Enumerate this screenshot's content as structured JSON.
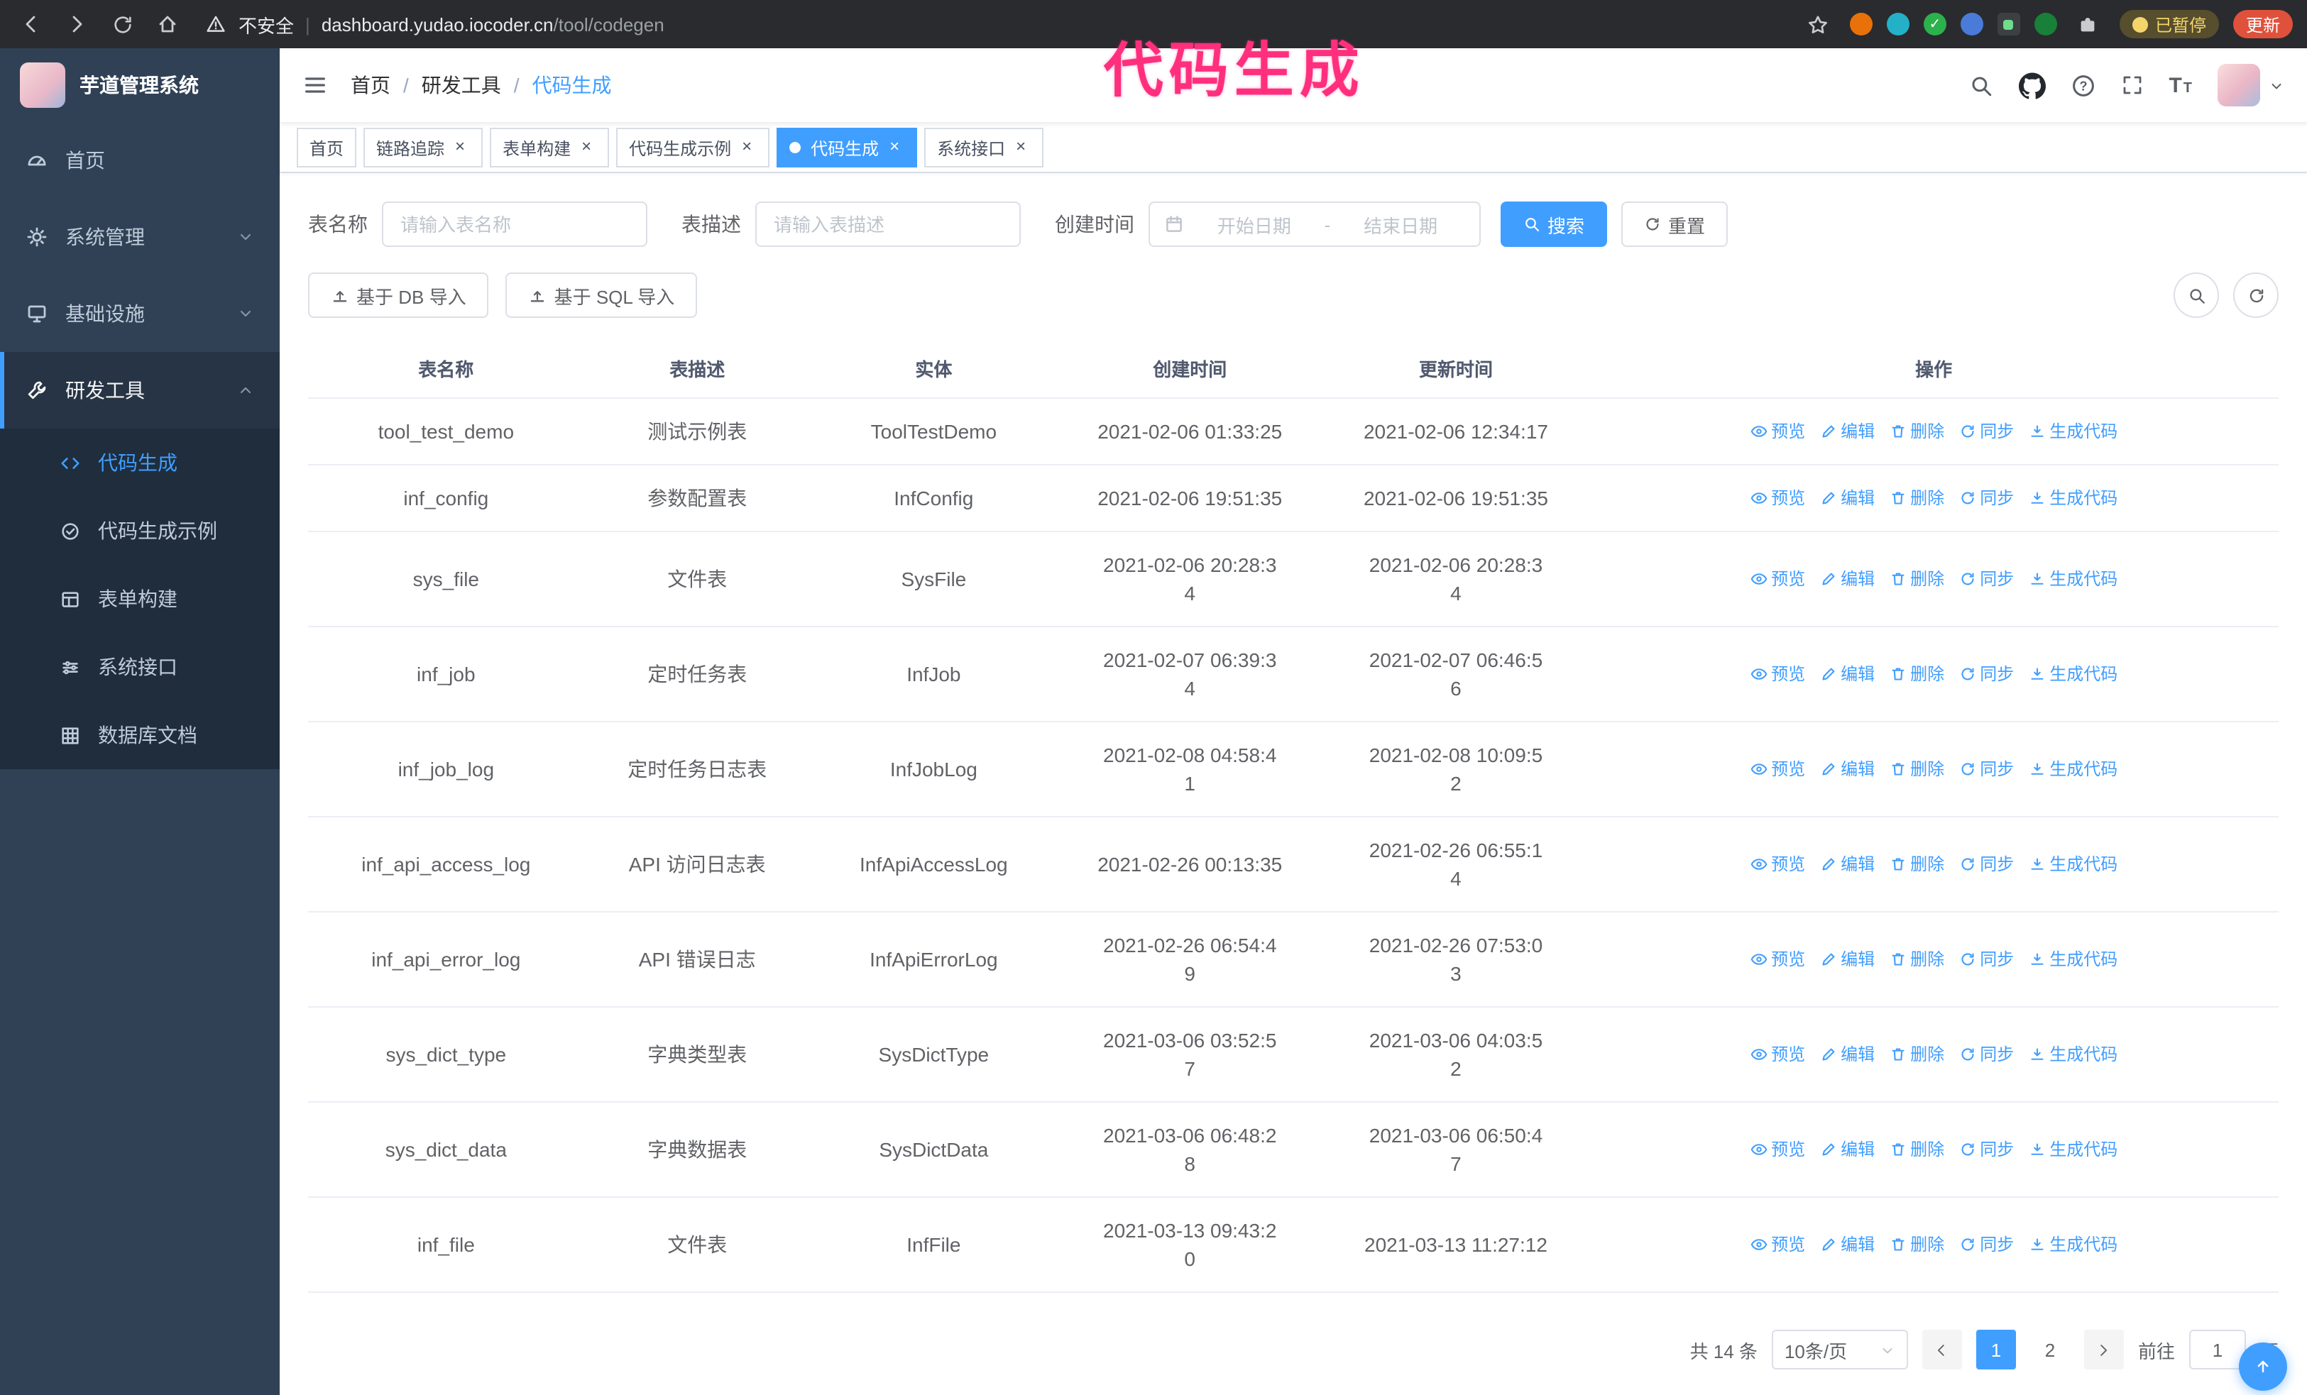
{
  "browser": {
    "security_warning": "不安全",
    "url_domain": "dashboard.yudao.iocoder.cn",
    "url_path": "/tool/codegen",
    "url_separator": "|",
    "paused_badge": "已暂停",
    "update_button": "更新"
  },
  "annotation": {
    "text": "代码生成",
    "color": "#ff2f7e"
  },
  "app": {
    "title": "芋道管理系统"
  },
  "sidebar": {
    "items": [
      {
        "label": "首页",
        "icon": "dashboard-icon"
      },
      {
        "label": "系统管理",
        "icon": "gear-icon"
      },
      {
        "label": "基础设施",
        "icon": "platform-icon"
      },
      {
        "label": "研发工具",
        "icon": "tools-icon"
      }
    ],
    "submenu": [
      {
        "label": "代码生成",
        "icon": "code-icon",
        "active": true
      },
      {
        "label": "代码生成示例",
        "icon": "example-icon"
      },
      {
        "label": "表单构建",
        "icon": "form-icon"
      },
      {
        "label": "系统接口",
        "icon": "api-icon"
      },
      {
        "label": "数据库文档",
        "icon": "db-doc-icon"
      }
    ]
  },
  "breadcrumb": [
    "首页",
    "研发工具",
    "代码生成"
  ],
  "navbar": {
    "font_icon_large": "T",
    "font_icon_small": "T"
  },
  "tabs": [
    {
      "label": "首页",
      "closable": false,
      "active": false
    },
    {
      "label": "链路追踪",
      "closable": true,
      "active": false
    },
    {
      "label": "表单构建",
      "closable": true,
      "active": false
    },
    {
      "label": "代码生成示例",
      "closable": true,
      "active": false
    },
    {
      "label": "代码生成",
      "closable": true,
      "active": true
    },
    {
      "label": "系统接口",
      "closable": true,
      "active": false
    }
  ],
  "filters": {
    "table_name_label": "表名称",
    "table_name_placeholder": "请输入表名称",
    "table_desc_label": "表描述",
    "table_desc_placeholder": "请输入表描述",
    "create_time_label": "创建时间",
    "date_start_placeholder": "开始日期",
    "date_separator": "-",
    "date_end_placeholder": "结束日期",
    "search_button": "搜索",
    "reset_button": "重置"
  },
  "toolbar": {
    "import_db": "基于 DB 导入",
    "import_sql": "基于 SQL 导入"
  },
  "table": {
    "columns": [
      "表名称",
      "表描述",
      "实体",
      "创建时间",
      "更新时间",
      "操作"
    ],
    "actions": [
      {
        "label": "预览",
        "icon": "eye"
      },
      {
        "label": "编辑",
        "icon": "edit"
      },
      {
        "label": "删除",
        "icon": "del"
      },
      {
        "label": "同步",
        "icon": "sync"
      },
      {
        "label": "生成代码",
        "icon": "code"
      }
    ],
    "rows": [
      {
        "name": "tool_test_demo",
        "desc": "测试示例表",
        "entity": "ToolTestDemo",
        "created": "2021-02-06 01:33:25",
        "updated": "2021-02-06 12:34:17"
      },
      {
        "name": "inf_config",
        "desc": "参数配置表",
        "entity": "InfConfig",
        "created": "2021-02-06 19:51:35",
        "updated": "2021-02-06 19:51:35"
      },
      {
        "name": "sys_file",
        "desc": "文件表",
        "entity": "SysFile",
        "created": "2021-02-06 20:28:3\n4",
        "updated": "2021-02-06 20:28:3\n4"
      },
      {
        "name": "inf_job",
        "desc": "定时任务表",
        "entity": "InfJob",
        "created": "2021-02-07 06:39:3\n4",
        "updated": "2021-02-07 06:46:5\n6"
      },
      {
        "name": "inf_job_log",
        "desc": "定时任务日志表",
        "entity": "InfJobLog",
        "created": "2021-02-08 04:58:4\n1",
        "updated": "2021-02-08 10:09:5\n2"
      },
      {
        "name": "inf_api_access_log",
        "desc": "API 访问日志表",
        "entity": "InfApiAccessLog",
        "created": "2021-02-26 00:13:35",
        "updated": "2021-02-26 06:55:1\n4"
      },
      {
        "name": "inf_api_error_log",
        "desc": "API 错误日志",
        "entity": "InfApiErrorLog",
        "created": "2021-02-26 06:54:4\n9",
        "updated": "2021-02-26 07:53:0\n3"
      },
      {
        "name": "sys_dict_type",
        "desc": "字典类型表",
        "entity": "SysDictType",
        "created": "2021-03-06 03:52:5\n7",
        "updated": "2021-03-06 04:03:5\n2"
      },
      {
        "name": "sys_dict_data",
        "desc": "字典数据表",
        "entity": "SysDictData",
        "created": "2021-03-06 06:48:2\n8",
        "updated": "2021-03-06 06:50:4\n7"
      },
      {
        "name": "inf_file",
        "desc": "文件表",
        "entity": "InfFile",
        "created": "2021-03-13 09:43:2\n0",
        "updated": "2021-03-13 11:27:12"
      }
    ]
  },
  "pagination": {
    "total": "共 14 条",
    "page_size": "10条/页",
    "pages": [
      "1",
      "2"
    ],
    "active_page": "1",
    "goto_label": "前往",
    "goto_value": "1",
    "goto_suffix": "页"
  },
  "colors": {
    "accent": "#409eff",
    "sidebar_bg": "#304156",
    "submenu_bg": "#1f2d3d",
    "annotation": "#ff2f7e",
    "border": "#dcdfe6",
    "row_border": "#ebeef5"
  }
}
